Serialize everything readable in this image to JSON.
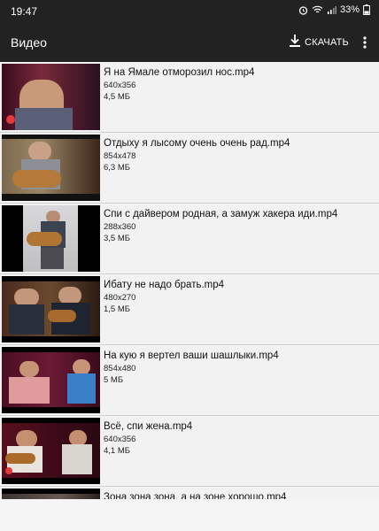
{
  "status": {
    "time": "19:47",
    "battery": "33%"
  },
  "toolbar": {
    "title": "Видео",
    "download_label": "СКАЧАТЬ"
  },
  "videos": [
    {
      "name": "Я на Ямале отморозил нос.mp4",
      "resolution": "640x356",
      "size": "4,5 МБ"
    },
    {
      "name": "Отдыху я лысому очень очень рад.mp4",
      "resolution": "854x478",
      "size": "6,3 МБ"
    },
    {
      "name": "Спи с дайвером родная, а замуж хакера иди.mp4",
      "resolution": "288x360",
      "size": "3,5 МБ"
    },
    {
      "name": "Ибату не надо брать.mp4",
      "resolution": "480x270",
      "size": "1,5 МБ"
    },
    {
      "name": "На кую я вертел ваши шашлыки.mp4",
      "resolution": "854x480",
      "size": "5 МБ"
    },
    {
      "name": "Всё, спи жена.mp4",
      "resolution": "640x356",
      "size": "4,1 МБ"
    },
    {
      "name": "Зона зона зона, а на зоне хорошо.mp4",
      "resolution": "",
      "size": ""
    }
  ]
}
